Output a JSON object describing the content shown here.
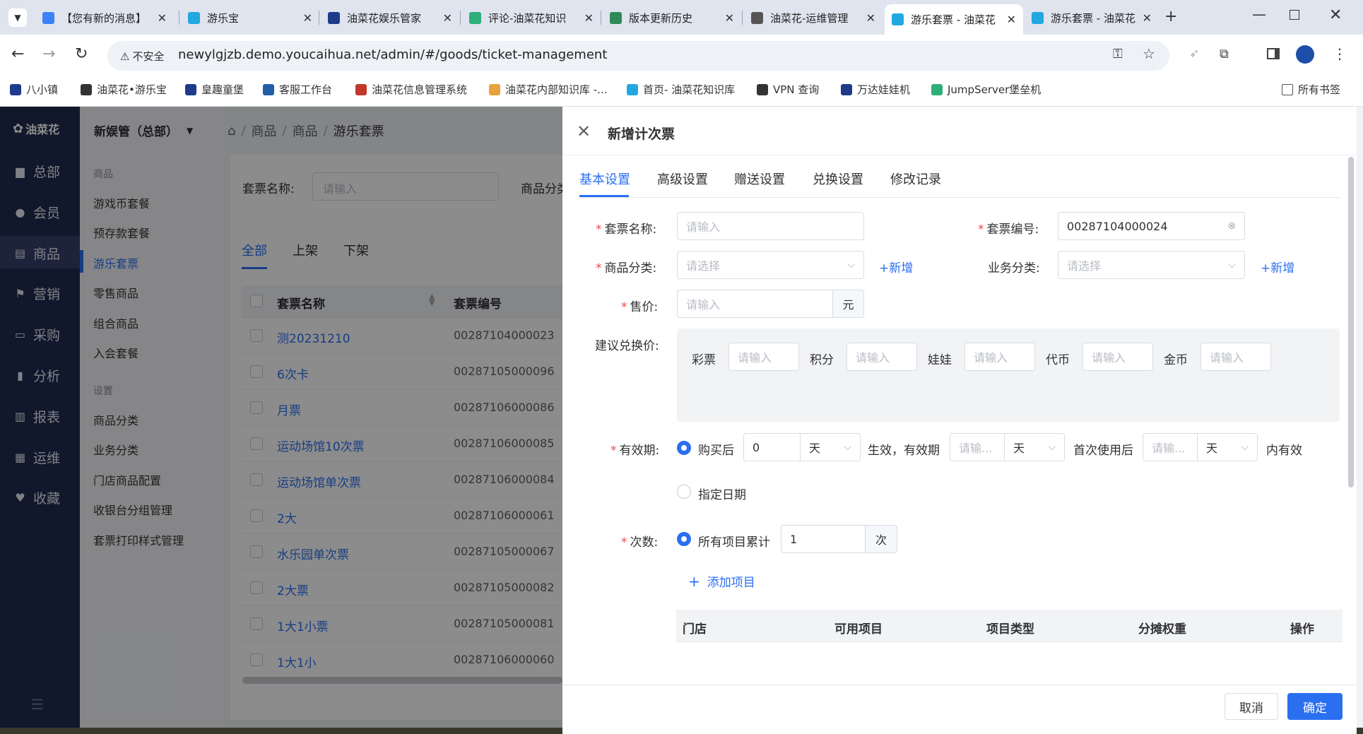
{
  "browser": {
    "tabs": [
      {
        "title": "【您有新的消息】",
        "color": "#3b82f6"
      },
      {
        "title": "游乐宝",
        "color": "#22a8e0"
      },
      {
        "title": "油菜花娱乐管家",
        "color": "#1e3a8a"
      },
      {
        "title": "评论-油菜花知识",
        "color": "#2fae7a"
      },
      {
        "title": "版本更新历史",
        "color": "#2e8b57"
      },
      {
        "title": "油菜花-运维管理",
        "color": "#555555"
      },
      {
        "title": "游乐套票 - 油菜花",
        "color": "#22a8e0"
      },
      {
        "title": "游乐套票 - 油菜花",
        "color": "#22a8e0"
      }
    ],
    "security_label": "不安全",
    "url": "newylgjzb.demo.youcaihua.net/admin/#/goods/ticket-management",
    "bookmarks": [
      "八小镇",
      "油菜花•游乐宝",
      "皇趣童堡",
      "客服工作台",
      "油菜花信息管理系统",
      "油菜花内部知识库 -...",
      "首页- 油菜花知识库",
      "VPN 查询",
      "万达娃娃机",
      "JumpServer堡垒机"
    ],
    "bookmarks_all": "所有书签"
  },
  "sidebar": {
    "logo": "油菜花",
    "items": [
      "总部",
      "会员",
      "商品",
      "营销",
      "采购",
      "分析",
      "报表",
      "运维",
      "收藏"
    ]
  },
  "submenu": {
    "store": "新娱管（总部）",
    "group1": "商品",
    "items1": [
      "游戏币套餐",
      "预存款套餐",
      "游乐套票",
      "零售商品",
      "组合商品",
      "入会套餐"
    ],
    "group2": "设置",
    "items2": [
      "商品分类",
      "业务分类",
      "门店商品配置",
      "收银台分组管理",
      "套票打印样式管理"
    ]
  },
  "main": {
    "breadcrumb": [
      "商品",
      "商品",
      "游乐套票"
    ],
    "filter_label": "套票名称:",
    "filter_placeholder": "请输入",
    "filter_label2": "商品分类",
    "tabs": [
      "全部",
      "上架",
      "下架"
    ],
    "columns": [
      "套票名称",
      "套票编号"
    ],
    "rows": [
      [
        "测20231210",
        "00287104000023"
      ],
      [
        "6次卡",
        "00287105000096"
      ],
      [
        "月票",
        "00287106000086"
      ],
      [
        "运动场馆10次票",
        "00287106000085"
      ],
      [
        "运动场馆单次票",
        "00287106000084"
      ],
      [
        "2大",
        "00287106000061"
      ],
      [
        "水乐园单次票",
        "00287105000067"
      ],
      [
        "2大票",
        "00287105000082"
      ],
      [
        "1大1小票",
        "00287105000081"
      ],
      [
        "1大1小",
        "00287106000060"
      ]
    ]
  },
  "drawer": {
    "title": "新增计次票",
    "tabs": [
      "基本设置",
      "高级设置",
      "赠送设置",
      "兑换设置",
      "修改记录"
    ],
    "name_label": "套票名称:",
    "name_placeholder": "请输入",
    "code_label": "套票编号:",
    "code_value": "00287104000024",
    "category_label": "商品分类:",
    "select_placeholder": "请选择",
    "add_link": "+新增",
    "biz_label": "业务分类:",
    "price_label": "售价:",
    "price_placeholder": "请输入",
    "price_unit": "元",
    "suggest_label": "建议兑换价:",
    "exchange": [
      "彩票",
      "积分",
      "娃娃",
      "代币",
      "金币"
    ],
    "validity_label": "有效期:",
    "after_purchase": "购买后",
    "days_value": "0",
    "day_unit": "天",
    "effective_text": "生效，有效期",
    "short_placeholder": "请输...",
    "first_use": "首次使用后",
    "within_valid": "内有效",
    "specify_date": "指定日期",
    "count_label": "次数:",
    "all_items": "所有项目累计",
    "count_value": "1",
    "count_unit": "次",
    "add_item": "添加项目",
    "table_cols": [
      "门店",
      "可用项目",
      "项目类型",
      "分摊权重",
      "操作"
    ],
    "cancel": "取消",
    "confirm": "确定"
  },
  "colors": {
    "accent": "#2a6ff0",
    "nav_bg": "#1f2d50",
    "required": "#f04848"
  }
}
